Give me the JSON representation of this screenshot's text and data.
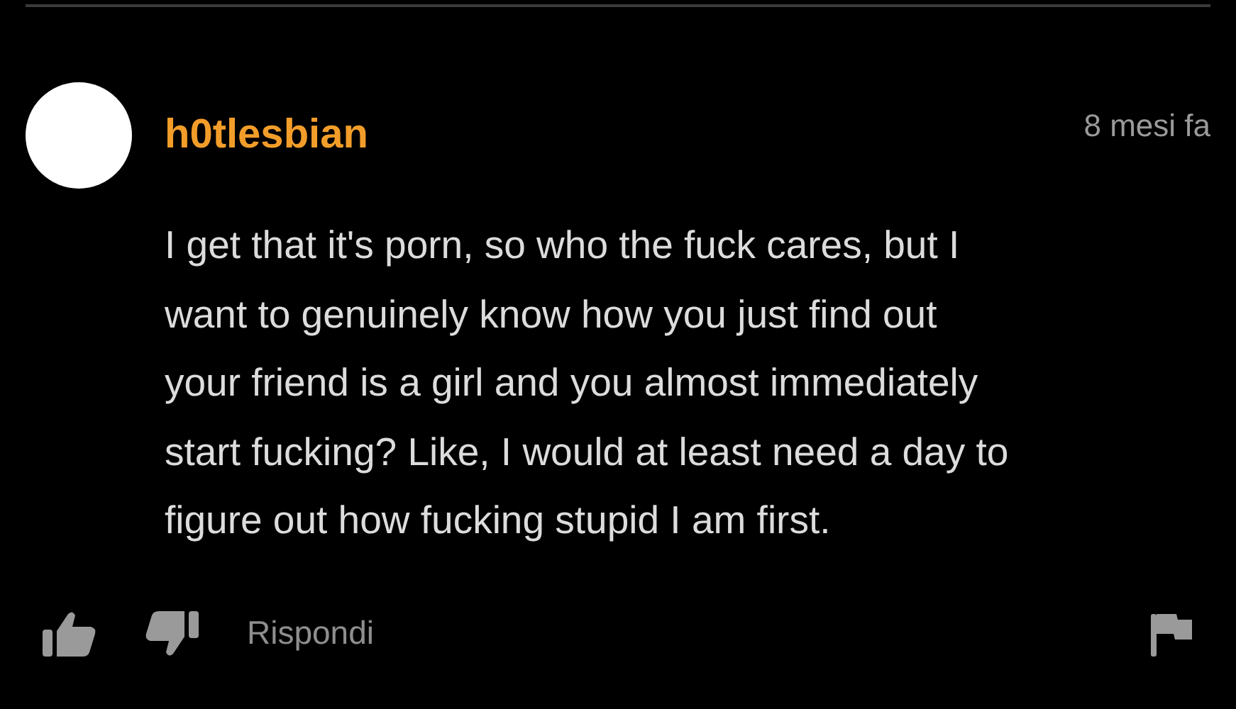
{
  "comment": {
    "username": "h0tlesbian",
    "time": "8 mesi fa",
    "body_lines": [
      "I get that it's porn, so who the fuck cares, but I",
      "want to genuinely know how you just find out",
      "your friend is a girl and you almost immediately",
      "start fucking? Like, I would at least need a day to",
      "figure out how fucking stupid I am first."
    ],
    "reply_label": "Rispondi"
  }
}
